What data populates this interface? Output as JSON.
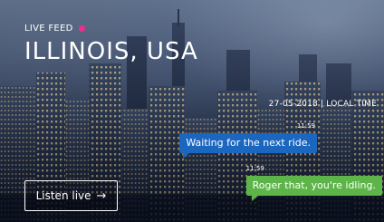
{
  "header": {
    "live_label": "LIVE FEED",
    "live_color": "#ec2f8a",
    "city": "ILLINOIS, USA"
  },
  "meta": {
    "date_line": "27-05-2018 | LOCAL TIME"
  },
  "messages": [
    {
      "time": "11:59",
      "text": "Waiting for the next ride.",
      "color": "#1b67c0"
    },
    {
      "time": "11:59",
      "text": "Roger that, you're idling.",
      "color": "#5db54a"
    }
  ],
  "actions": {
    "listen_label": "Listen live",
    "listen_icon": "arrow-right-icon",
    "arrow": "→"
  }
}
